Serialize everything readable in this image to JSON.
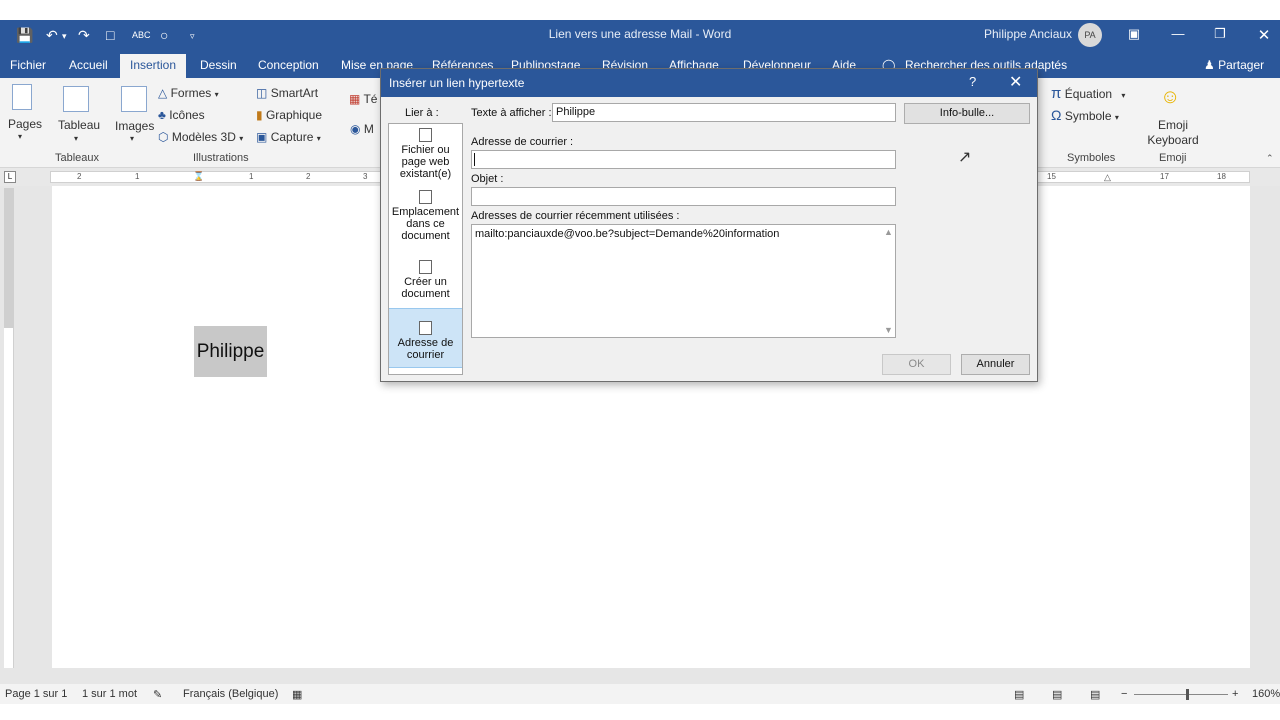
{
  "window": {
    "title": "Lien vers une adresse Mail  -  Word",
    "user": "Philippe Anciaux",
    "avatar": "PA"
  },
  "tabs": [
    "Fichier",
    "Accueil",
    "Insertion",
    "Dessin",
    "Conception",
    "Mise en page",
    "Références",
    "Publipostage",
    "Révision",
    "Affichage",
    "Développeur",
    "Aide"
  ],
  "active_tab": "Insertion",
  "search": "Rechercher des outils adaptés",
  "share": "Partager",
  "ribbon": {
    "pages": "Pages",
    "tableau": "Tableau",
    "tableaux_group": "Tableaux",
    "images": "Images",
    "formes": "Formes",
    "icones": "Icônes",
    "modeles3d": "Modèles 3D",
    "smartart": "SmartArt",
    "graphique": "Graphique",
    "capture": "Capture",
    "illustrations_group": "Illustrations",
    "te": "Té",
    "m": "M",
    "equation": "Équation",
    "symbole": "Symbole",
    "symboles_group": "Symboles",
    "emoji_keyboard": "Emoji Keyboard",
    "emoji_group": "Emoji"
  },
  "ruler": {
    "left_ticks": [
      "2",
      "1",
      "1",
      "2",
      "3"
    ],
    "right_ticks": [
      "15",
      "17",
      "18"
    ]
  },
  "document": {
    "text": "Philippe"
  },
  "dialog": {
    "title": "Insérer un lien hypertexte",
    "help": "?",
    "lier_a": "Lier à :",
    "texte_label": "Texte à afficher :",
    "texte_value": "Philippe",
    "infobulle": "Info-bulle...",
    "adresse_label": "Adresse de courrier :",
    "adresse_value": "",
    "objet_label": "Objet :",
    "objet_value": "",
    "recent_label": "Adresses de courrier récemment utilisées :",
    "recent_items": [
      "mailto:panciauxde@voo.be?subject=Demande%20information"
    ],
    "link_options": [
      {
        "label": "Fichier ou page web existant(e)"
      },
      {
        "label": "Emplacement dans ce document"
      },
      {
        "label": "Créer un document"
      },
      {
        "label": "Adresse de courrier"
      }
    ],
    "selected_option": 3,
    "ok": "OK",
    "annuler": "Annuler"
  },
  "status": {
    "page": "Page 1 sur 1",
    "words": "1 sur 1 mot",
    "language": "Français (Belgique)",
    "zoom": "160%",
    "zoom_minus": "−",
    "zoom_plus": "+"
  }
}
